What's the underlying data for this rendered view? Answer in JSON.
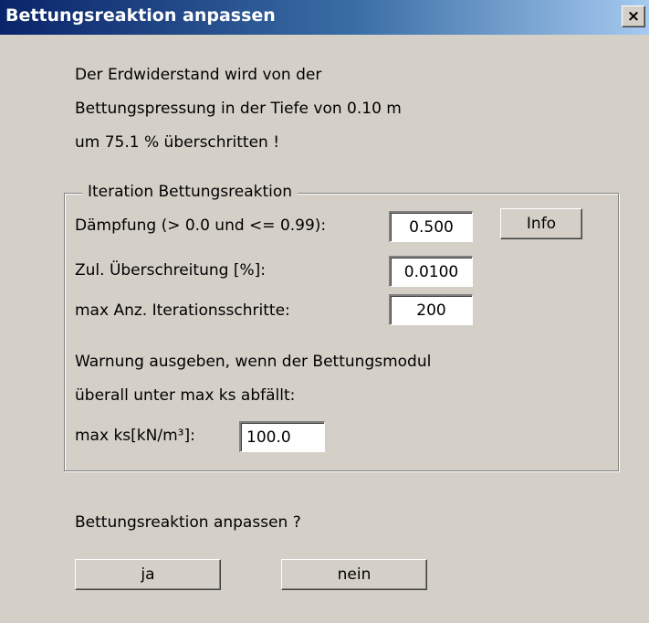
{
  "dialog": {
    "title": "Bettungsreaktion anpassen",
    "close_glyph": "×"
  },
  "message": {
    "line1": "Der Erdwiderstand wird von der",
    "line2": "Bettungspressung in der Tiefe von 0.10 m",
    "line3": "um 75.1 % überschritten !"
  },
  "iteration_group": {
    "title": "Iteration Bettungsreaktion",
    "damping_label": "Dämpfung (> 0.0 und <= 0.99):",
    "damping_value": "0.500",
    "info_label": "Info",
    "exceed_label": "Zul. Überschreitung [%]:",
    "exceed_value": "0.0100",
    "max_steps_label": "max Anz. Iterationsschritte:",
    "max_steps_value": "200",
    "warning_line1": "Warnung ausgeben, wenn der Bettungsmodul",
    "warning_line2": "überall unter max ks abfällt:",
    "max_ks_label": "max ks[kN/m³]:",
    "max_ks_value": "100.0"
  },
  "question": "Bettungsreaktion anpassen ?",
  "buttons": {
    "yes": "ja",
    "no": "nein"
  }
}
